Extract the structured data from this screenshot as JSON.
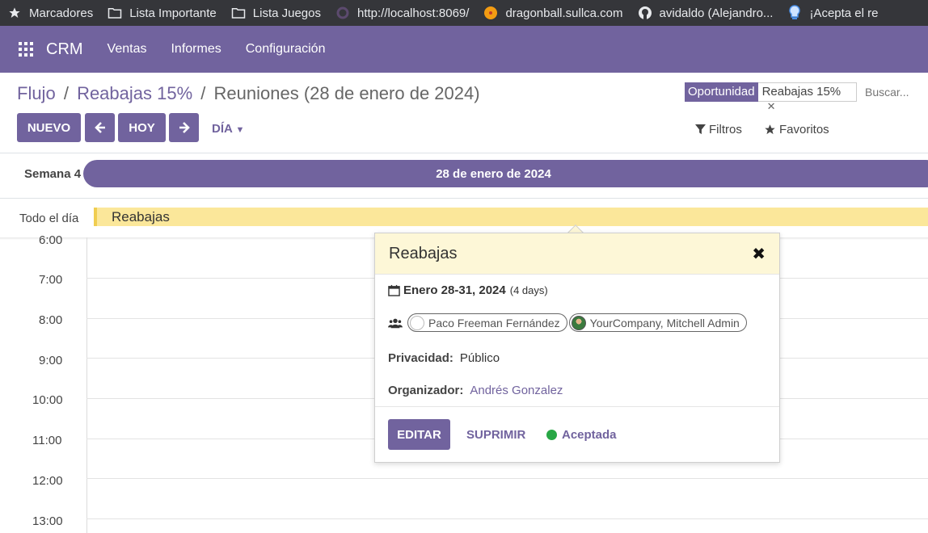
{
  "bookmarks": [
    {
      "label": "Marcadores",
      "icon": "star-icon"
    },
    {
      "label": "Lista Importante",
      "icon": "folder-icon"
    },
    {
      "label": "Lista Juegos",
      "icon": "folder-icon"
    },
    {
      "label": "http://localhost:8069/",
      "icon": "odoo-icon"
    },
    {
      "label": "dragonball.sullca.com",
      "icon": "dragonball-icon"
    },
    {
      "label": "avidaldo (Alejandro...",
      "icon": "github-icon"
    },
    {
      "label": "¡Acepta el re",
      "icon": "bulb-icon"
    }
  ],
  "navbar": {
    "brand": "CRM",
    "menu": [
      "Ventas",
      "Informes",
      "Configuración"
    ]
  },
  "breadcrumb": {
    "items": [
      "Flujo",
      "Reabajas 15%"
    ],
    "current": "Reuniones (28 de enero de 2024)",
    "separator": "/"
  },
  "search": {
    "facet_type": "Oportunidad",
    "facet_value": "Reabajas 15%",
    "placeholder": "Buscar..."
  },
  "toolbar": {
    "new_label": "NUEVO",
    "today_label": "HOY",
    "scale_label": "DÍA",
    "filters_label": "Filtros",
    "favorites_label": "Favoritos"
  },
  "calendar": {
    "week_label": "Semana 4",
    "date_label": "28 de enero de 2024",
    "allday_label": "Todo el día",
    "allday_event": "Reabajas",
    "hours": [
      "6:00",
      "7:00",
      "8:00",
      "9:00",
      "10:00",
      "11:00",
      "12:00",
      "13:00"
    ]
  },
  "popover": {
    "title": "Reabajas",
    "date": "Enero 28-31, 2024",
    "duration": "(4 days)",
    "attendees": [
      "Paco Freeman Fernández",
      "YourCompany, Mitchell Admin"
    ],
    "privacy_label": "Privacidad:",
    "privacy_value": "Público",
    "organizer_label": "Organizador:",
    "organizer_value": "Andrés Gonzalez",
    "edit_label": "EDITAR",
    "delete_label": "SUPRIMIR",
    "status_label": "Aceptada",
    "status_color": "#28a745"
  },
  "colors": {
    "brand": "#71639e",
    "event_bg": "#fbe79a",
    "popover_header": "#fdf7d7"
  }
}
